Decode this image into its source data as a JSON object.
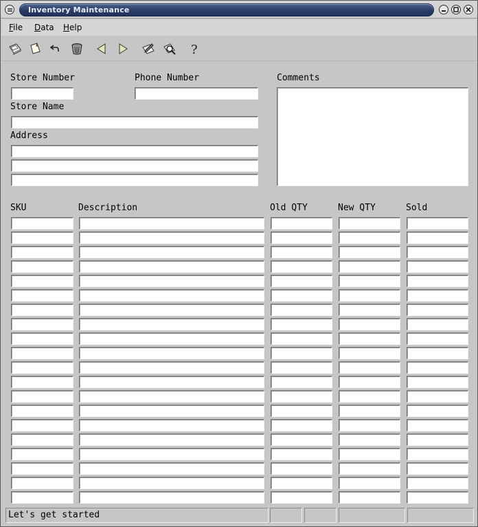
{
  "window": {
    "title": "Inventory Maintenance"
  },
  "menubar": {
    "items": [
      {
        "label": "File"
      },
      {
        "label": "Data"
      },
      {
        "label": "Help"
      }
    ]
  },
  "toolbar": {
    "buttons": [
      {
        "icon": "save-disk-icon"
      },
      {
        "icon": "new-document-icon"
      },
      {
        "icon": "undo-icon"
      },
      {
        "icon": "delete-trash-icon"
      },
      {
        "icon": "previous-arrow-icon"
      },
      {
        "icon": "next-arrow-icon"
      },
      {
        "icon": "edit-note-icon"
      },
      {
        "icon": "find-magnifier-icon"
      },
      {
        "icon": "help-question-icon"
      }
    ]
  },
  "form": {
    "store_number": {
      "label": "Store Number",
      "value": ""
    },
    "phone_number": {
      "label": "Phone Number",
      "value": ""
    },
    "comments": {
      "label": "Comments",
      "value": ""
    },
    "store_name": {
      "label": "Store Name",
      "value": ""
    },
    "address": {
      "label": "Address",
      "lines": [
        "",
        "",
        ""
      ]
    }
  },
  "grid": {
    "columns": [
      "SKU",
      "Description",
      "Old QTY",
      "New QTY",
      "Sold"
    ],
    "row_count": 20,
    "rows": []
  },
  "status": {
    "message": "Let's get started",
    "panels": [
      "",
      "",
      "",
      ""
    ]
  }
}
